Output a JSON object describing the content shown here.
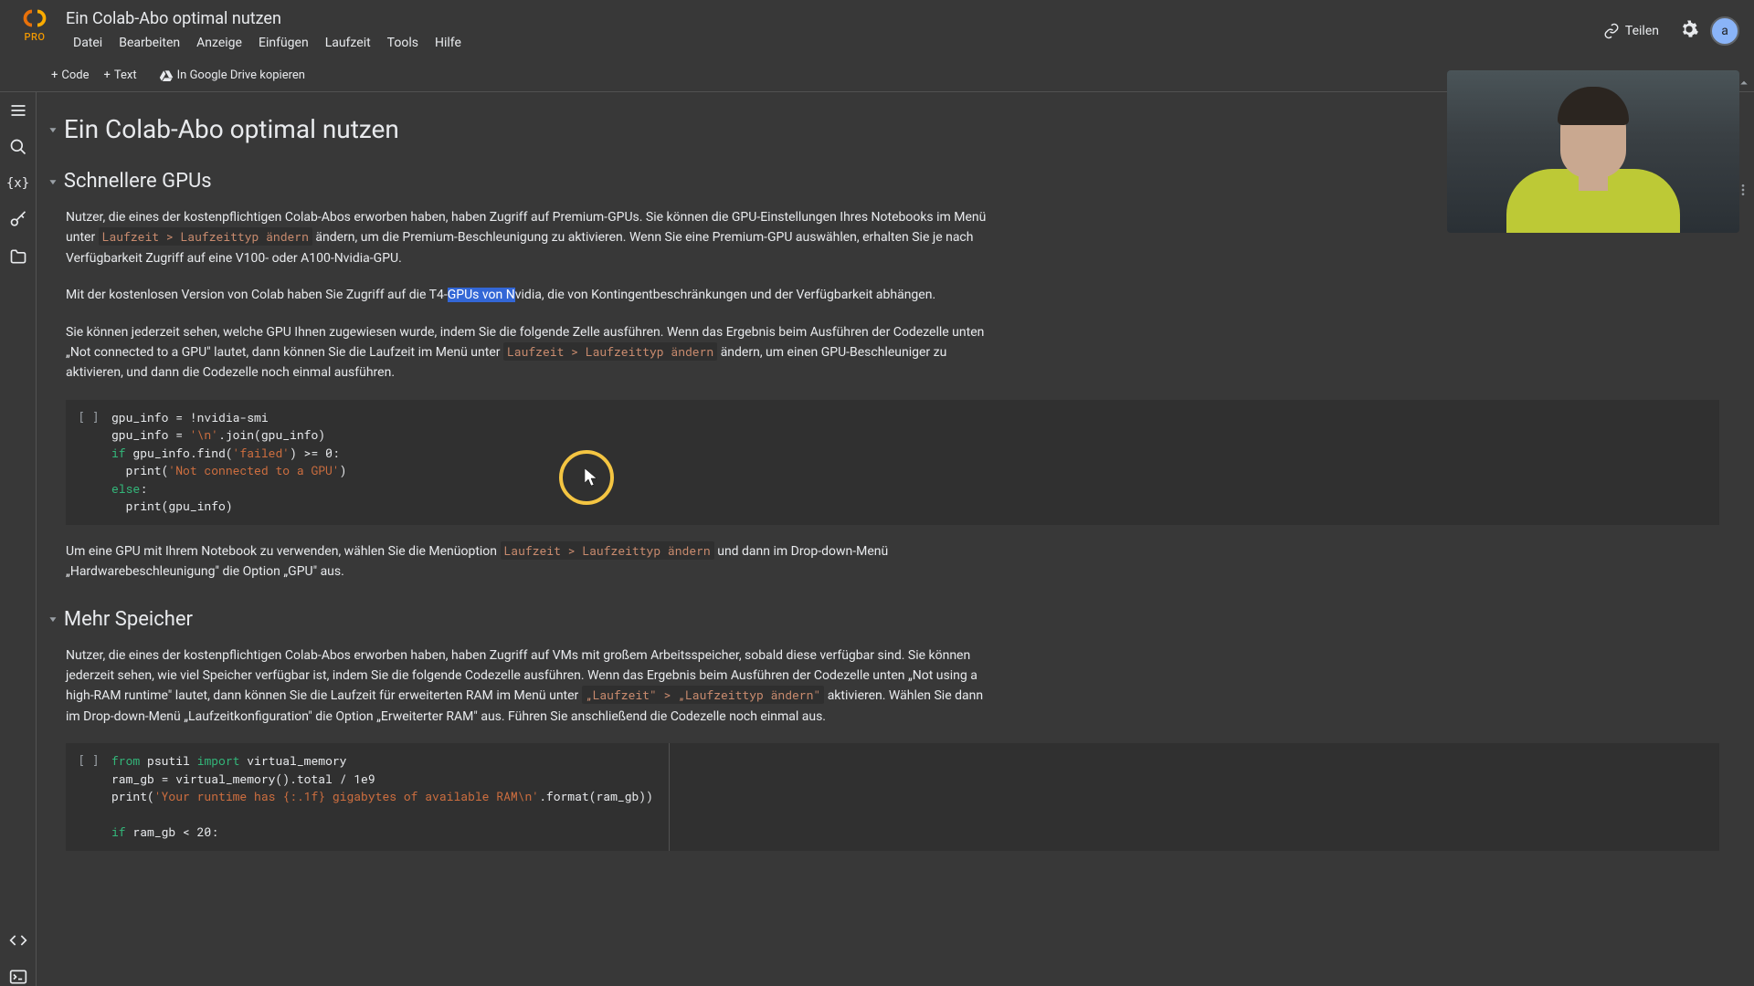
{
  "header": {
    "title": "Ein Colab-Abo optimal nutzen",
    "pro_label": "PRO",
    "menu": [
      "Datei",
      "Bearbeiten",
      "Anzeige",
      "Einfügen",
      "Laufzeit",
      "Tools",
      "Hilfe"
    ],
    "share": "Teilen",
    "avatar": "a"
  },
  "toolbar": {
    "code": "Code",
    "text": "Text",
    "copy": "In Google Drive kopieren"
  },
  "content": {
    "title": "Ein Colab-Abo optimal nutzen",
    "s1_title": "Schnellere GPUs",
    "p1a": "Nutzer, die eines der kostenpflichtigen Colab-Abos erworben haben, haben Zugriff auf Premium-GPUs. Sie können die GPU-Einstellungen Ihres Notebooks im Menü unter ",
    "p1_code": "Laufzeit > Laufzeittyp ändern",
    "p1b": " ändern, um die Premium-Beschleunigung zu aktivieren. Wenn Sie eine Premium-GPU auswählen, erhalten Sie je nach Verfügbarkeit Zugriff auf eine V100- oder A100-Nvidia-GPU.",
    "p2a": "Mit der kostenlosen Version von Colab haben Sie Zugriff auf die T4-",
    "p2_sel": "GPUs von N",
    "p2b": "vidia, die von Kontingentbeschränkungen und der Verfügbarkeit abhängen.",
    "p3a": "Sie können jederzeit sehen, welche GPU Ihnen zugewiesen wurde, indem Sie die folgende Zelle ausführen. Wenn das Ergebnis beim Ausführen der Codezelle unten „Not connected to a GPU\" lautet, dann können Sie die Laufzeit im Menü unter ",
    "p3_code": "Laufzeit > Laufzeittyp ändern",
    "p3b": " ändern, um einen GPU-Beschleuniger zu aktivieren, und dann die Codezelle noch einmal ausführen.",
    "cell1_gutter": "[ ]",
    "p4a": "Um eine GPU mit Ihrem Notebook zu verwenden, wählen Sie die Menüoption ",
    "p4_code": "Laufzeit > Laufzeittyp ändern",
    "p4b": " und dann im Drop-down-Menü „Hardwarebeschleunigung\" die Option „GPU\" aus.",
    "s2_title": "Mehr Speicher",
    "p5a": "Nutzer, die eines der kostenpflichtigen Colab-Abos erworben haben, haben Zugriff auf VMs mit großem Arbeitsspeicher, sobald diese verfügbar sind. Sie können jederzeit sehen, wie viel Speicher verfügbar ist, indem Sie die folgende Codezelle ausführen. Wenn das Ergebnis beim Ausführen der Codezelle unten „Not using a high-RAM runtime\" lautet, dann können Sie die Laufzeit für erweiterten RAM im Menü unter ",
    "p5_code": "„Laufzeit\" > „Laufzeittyp ändern\"",
    "p5b": " aktivieren. Wählen Sie dann im Drop-down-Menü „Laufzeitkonfiguration\" die Option „Erweiterter RAM\" aus. Führen Sie anschließend die Codezelle noch einmal aus.",
    "cell2_gutter": "[ ]"
  },
  "code1": {
    "l1a": "gpu_info = !nvidia-smi",
    "l2a": "gpu_info = ",
    "l2b": "'\\n'",
    "l2c": ".join(gpu_info)",
    "l3a": "if",
    "l3b": " gpu_info.find(",
    "l3c": "'failed'",
    "l3d": ") >= ",
    "l3e": "0",
    "l3f": ":",
    "l4a": "  print(",
    "l4b": "'Not connected to a GPU'",
    "l4c": ")",
    "l5a": "else",
    "l5b": ":",
    "l6a": "  print(gpu_info)"
  },
  "code2": {
    "l1a": "from",
    "l1b": " psutil ",
    "l1c": "import",
    "l1d": " virtual_memory",
    "l2a": "ram_gb = virtual_memory().total / ",
    "l2b": "1e9",
    "l3a": "print(",
    "l3b": "'Your runtime has {:.1f} gigabytes of available RAM\\n'",
    "l3c": ".format(ram_gb))",
    "l4": "",
    "l5a": "if",
    "l5b": " ram_gb < ",
    "l5c": "20",
    "l5d": ":"
  }
}
